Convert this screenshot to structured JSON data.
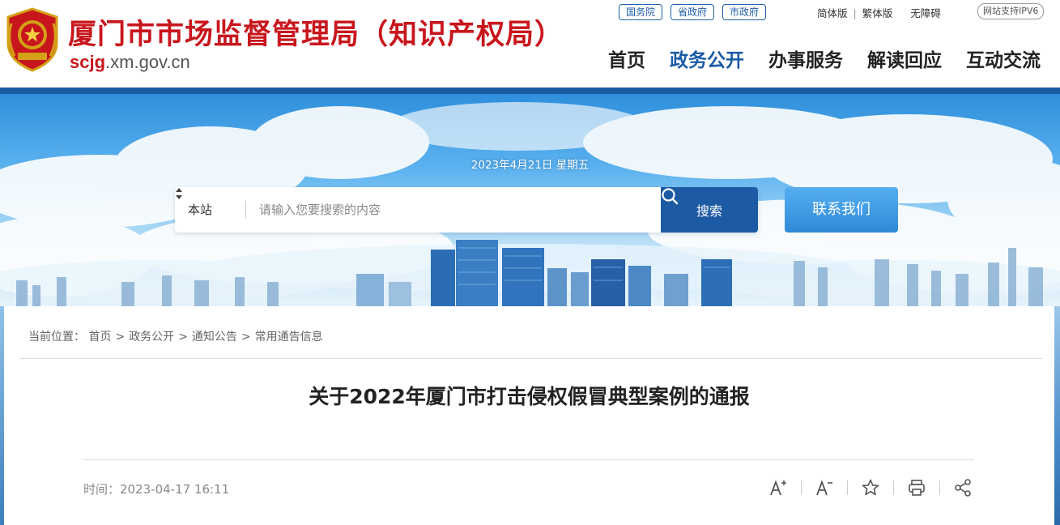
{
  "header": {
    "site_title": "厦门市市场监督管理局（知识产权局）",
    "domain_strong": "scjg",
    "domain_rest": ".xm.gov.cn",
    "gov_links": [
      "国务院",
      "省政府",
      "市政府"
    ],
    "lang_links": [
      "简体版",
      "繁体版",
      "无障碍"
    ],
    "ipv6_badge": "网站支持IPV6",
    "nav": [
      "首页",
      "政务公开",
      "办事服务",
      "解读回应",
      "互动交流"
    ],
    "active_nav": "政务公开",
    "colors": {
      "title_red": "#c8161d",
      "nav_blue": "#1a5aa6",
      "bar_blue": "#1b5aa5"
    }
  },
  "banner": {
    "date": "2023年4月21日 星期五",
    "search": {
      "scope": "本站",
      "placeholder": "请输入您要搜索的内容",
      "button": "搜索"
    },
    "contact_button": "联系我们"
  },
  "content": {
    "breadcrumb": {
      "prefix": "当前位置：",
      "items": [
        "首页",
        "政务公开",
        "通知公告",
        "常用通告信息"
      ]
    },
    "title": "关于2022年厦门市打击侵权假冒典型案例的通报",
    "time_label": "时间：2023-04-17 16:11",
    "tools": [
      "font-increase-icon",
      "font-decrease-icon",
      "star-icon",
      "print-icon",
      "share-icon"
    ]
  }
}
